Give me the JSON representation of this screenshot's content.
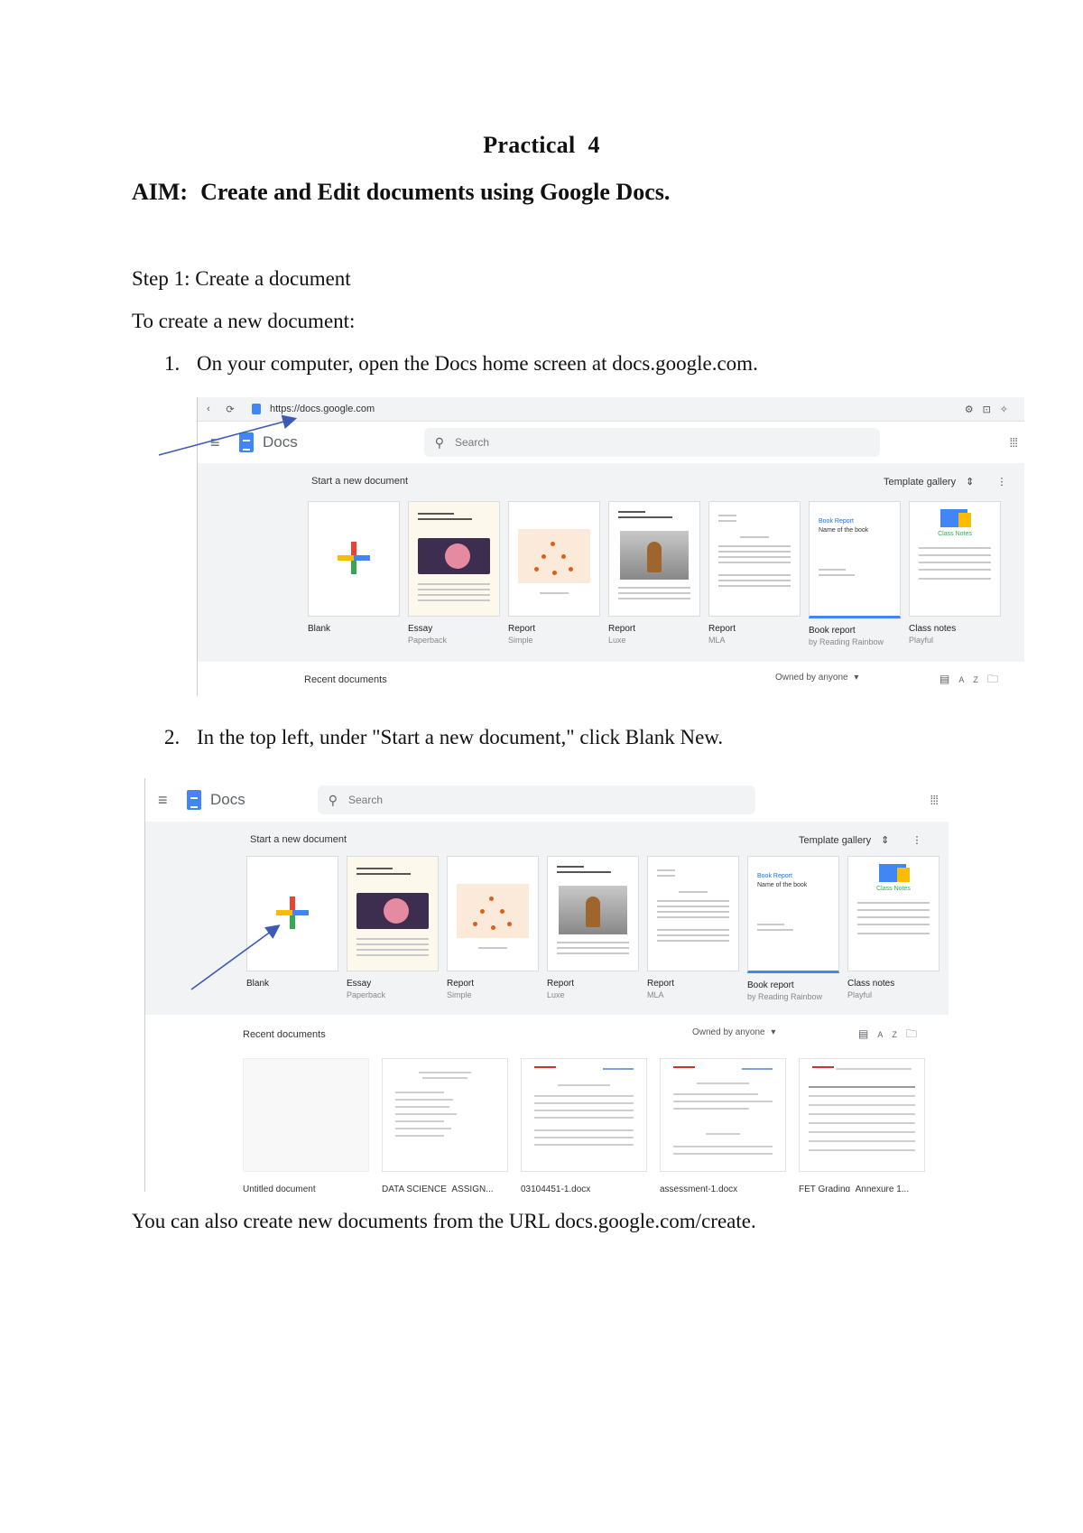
{
  "doc": {
    "title_word": "Practical",
    "title_num": "4",
    "aim_label": "AIM:",
    "aim_text": "Create and Edit documents using Google Docs.",
    "step1": "Step 1: Create a document",
    "to_create": "To create a new document:",
    "li1_num": "1.",
    "li1_text": "On your computer, open the Docs home screen at docs.google.com.",
    "li2_num": "2.",
    "li2_text": "In the top left, under \"Start a new document,\" click Blank New.",
    "footer": "You can also create new documents from the URL docs.google.com/create."
  },
  "shot1": {
    "url": "https://docs.google.com",
    "brand": "Docs",
    "search_placeholder": "Search",
    "gallery_heading": "Start a new document",
    "template_gallery": "Template gallery",
    "recent_heading": "Recent documents",
    "owned_by": "Owned by anyone"
  },
  "shot2": {
    "brand": "Docs",
    "search_placeholder": "Search",
    "gallery_heading": "Start a new document",
    "template_gallery": "Template gallery",
    "recent_heading": "Recent documents",
    "owned_by": "Owned by anyone"
  },
  "templates": [
    {
      "name": "Blank",
      "sub": ""
    },
    {
      "name": "Essay",
      "sub": "Paperback"
    },
    {
      "name": "Report",
      "sub": "Simple"
    },
    {
      "name": "Report",
      "sub": "Luxe"
    },
    {
      "name": "Report",
      "sub": "MLA"
    },
    {
      "name": "Book report",
      "sub": "by Reading Rainbow"
    },
    {
      "name": "Class notes",
      "sub": "Playful"
    }
  ],
  "recent_docs": [
    {
      "name": "Untitled document"
    },
    {
      "name": "DATA SCIENCE_ASSIGN..."
    },
    {
      "name": "03104451-1.docx"
    },
    {
      "name": "assessment-1.docx"
    },
    {
      "name": "FET Grading_Annexure 1..."
    }
  ],
  "icons": {
    "back": "‹",
    "reload": "⟳",
    "menu": "≡",
    "search": "⚲",
    "apps": "⁞⁞⁞",
    "sort": "⇕",
    "more": "⋮",
    "dropdown": "▾",
    "list_view": "▤",
    "az": "AZ",
    "folder": "🗀"
  }
}
